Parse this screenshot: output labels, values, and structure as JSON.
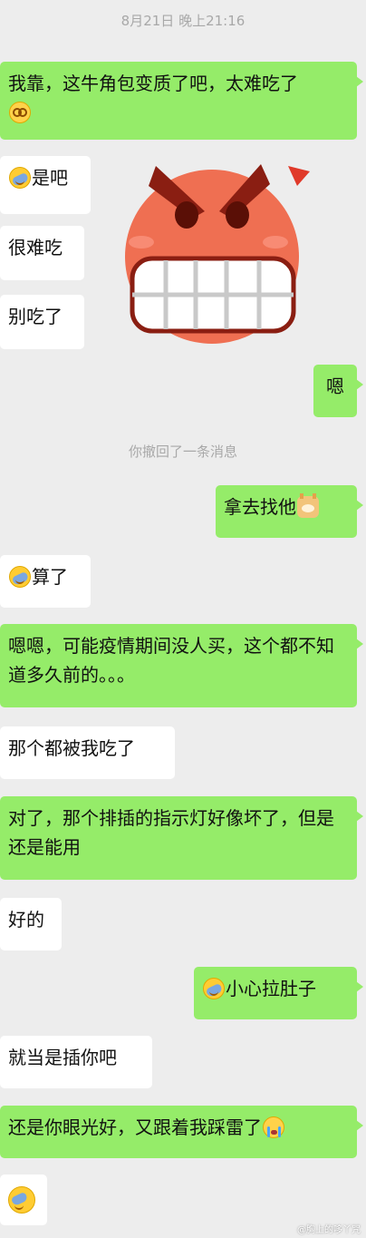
{
  "timestamp": "8月21日 晚上21:16",
  "recall_notice": "你撤回了一条消息",
  "messages": [
    {
      "text": "我靠，这牛角包变质了吧，太难吃了"
    },
    {
      "text": "是吧"
    },
    {
      "text": "很难吃"
    },
    {
      "text": "别吃了"
    },
    {
      "text": "嗯"
    },
    {
      "text": "拿去找他"
    },
    {
      "text": "算了"
    },
    {
      "text": "嗯嗯，可能疫情期间没人买，这个都不知道多久前的。。。"
    },
    {
      "text": "那个都被我吃了"
    },
    {
      "text": "对了，那个排插的指示灯好像坏了，但是还是能用"
    },
    {
      "text": "好的"
    },
    {
      "text": "小心拉肚子"
    },
    {
      "text": "就当是插你吧"
    },
    {
      "text": "还是你眼光好，又跟着我踩雷了"
    }
  ],
  "watermark": "@胸上的哆丫咒",
  "colors": {
    "mine": "#95ec69",
    "theirs": "#ffffff",
    "background": "#ededed"
  }
}
